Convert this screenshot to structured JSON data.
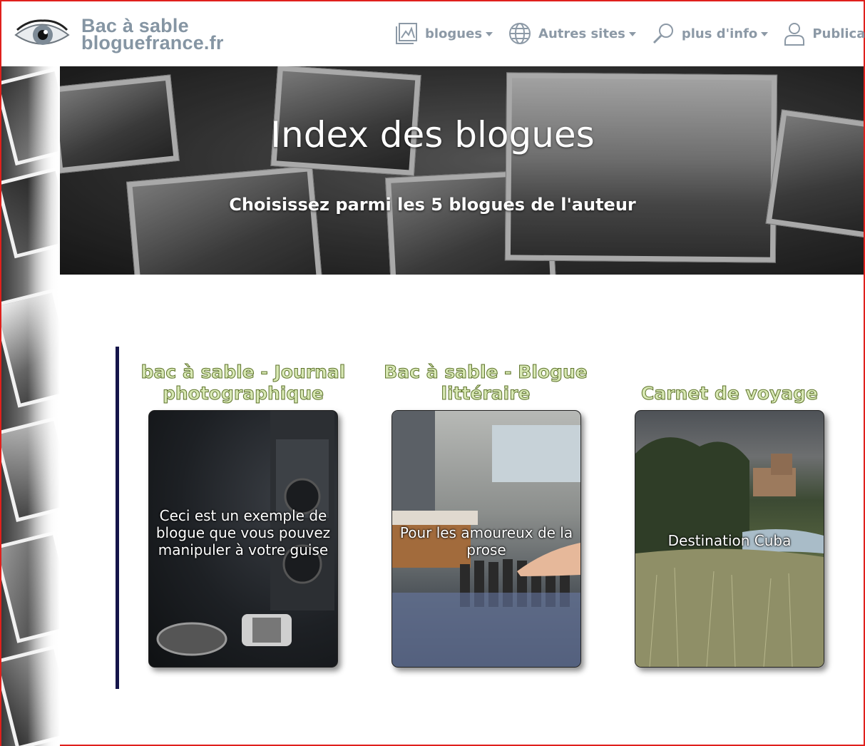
{
  "header": {
    "brand_line1": "Bac à sable",
    "brand_line2": "bloguefrance.fr",
    "nav": [
      {
        "label": "blogues",
        "icon": "chart-image-icon",
        "dropdown": true
      },
      {
        "label": "Autres sites",
        "icon": "globe-icon",
        "dropdown": true
      },
      {
        "label": "plus d'info",
        "icon": "search-icon",
        "dropdown": true
      },
      {
        "label": "Publicat",
        "icon": "user-icon",
        "dropdown": false
      }
    ]
  },
  "hero": {
    "title": "Index des blogues",
    "subtitle": "Choisissez parmi les 5 blogues de l'auteur"
  },
  "blogs": [
    {
      "title": "bac à sable - Journal photographique",
      "caption": "Ceci est un exemple de blogue que vous pouvez manipuler à votre guise",
      "image": "camera-photo"
    },
    {
      "title": "Bac à sable - Blogue littéraire",
      "caption": "Pour les amoureux de la prose",
      "image": "books-photo"
    },
    {
      "title": "Carnet de voyage",
      "caption": "Destination Cuba",
      "image": "landscape-photo"
    }
  ],
  "colors": {
    "brand": "#8595a3",
    "nav_text": "#8c99a6",
    "title_fill": "#d8e8b4",
    "title_stroke": "#5c7229",
    "accent_bar": "#15154a",
    "page_border": "#e0201c"
  }
}
